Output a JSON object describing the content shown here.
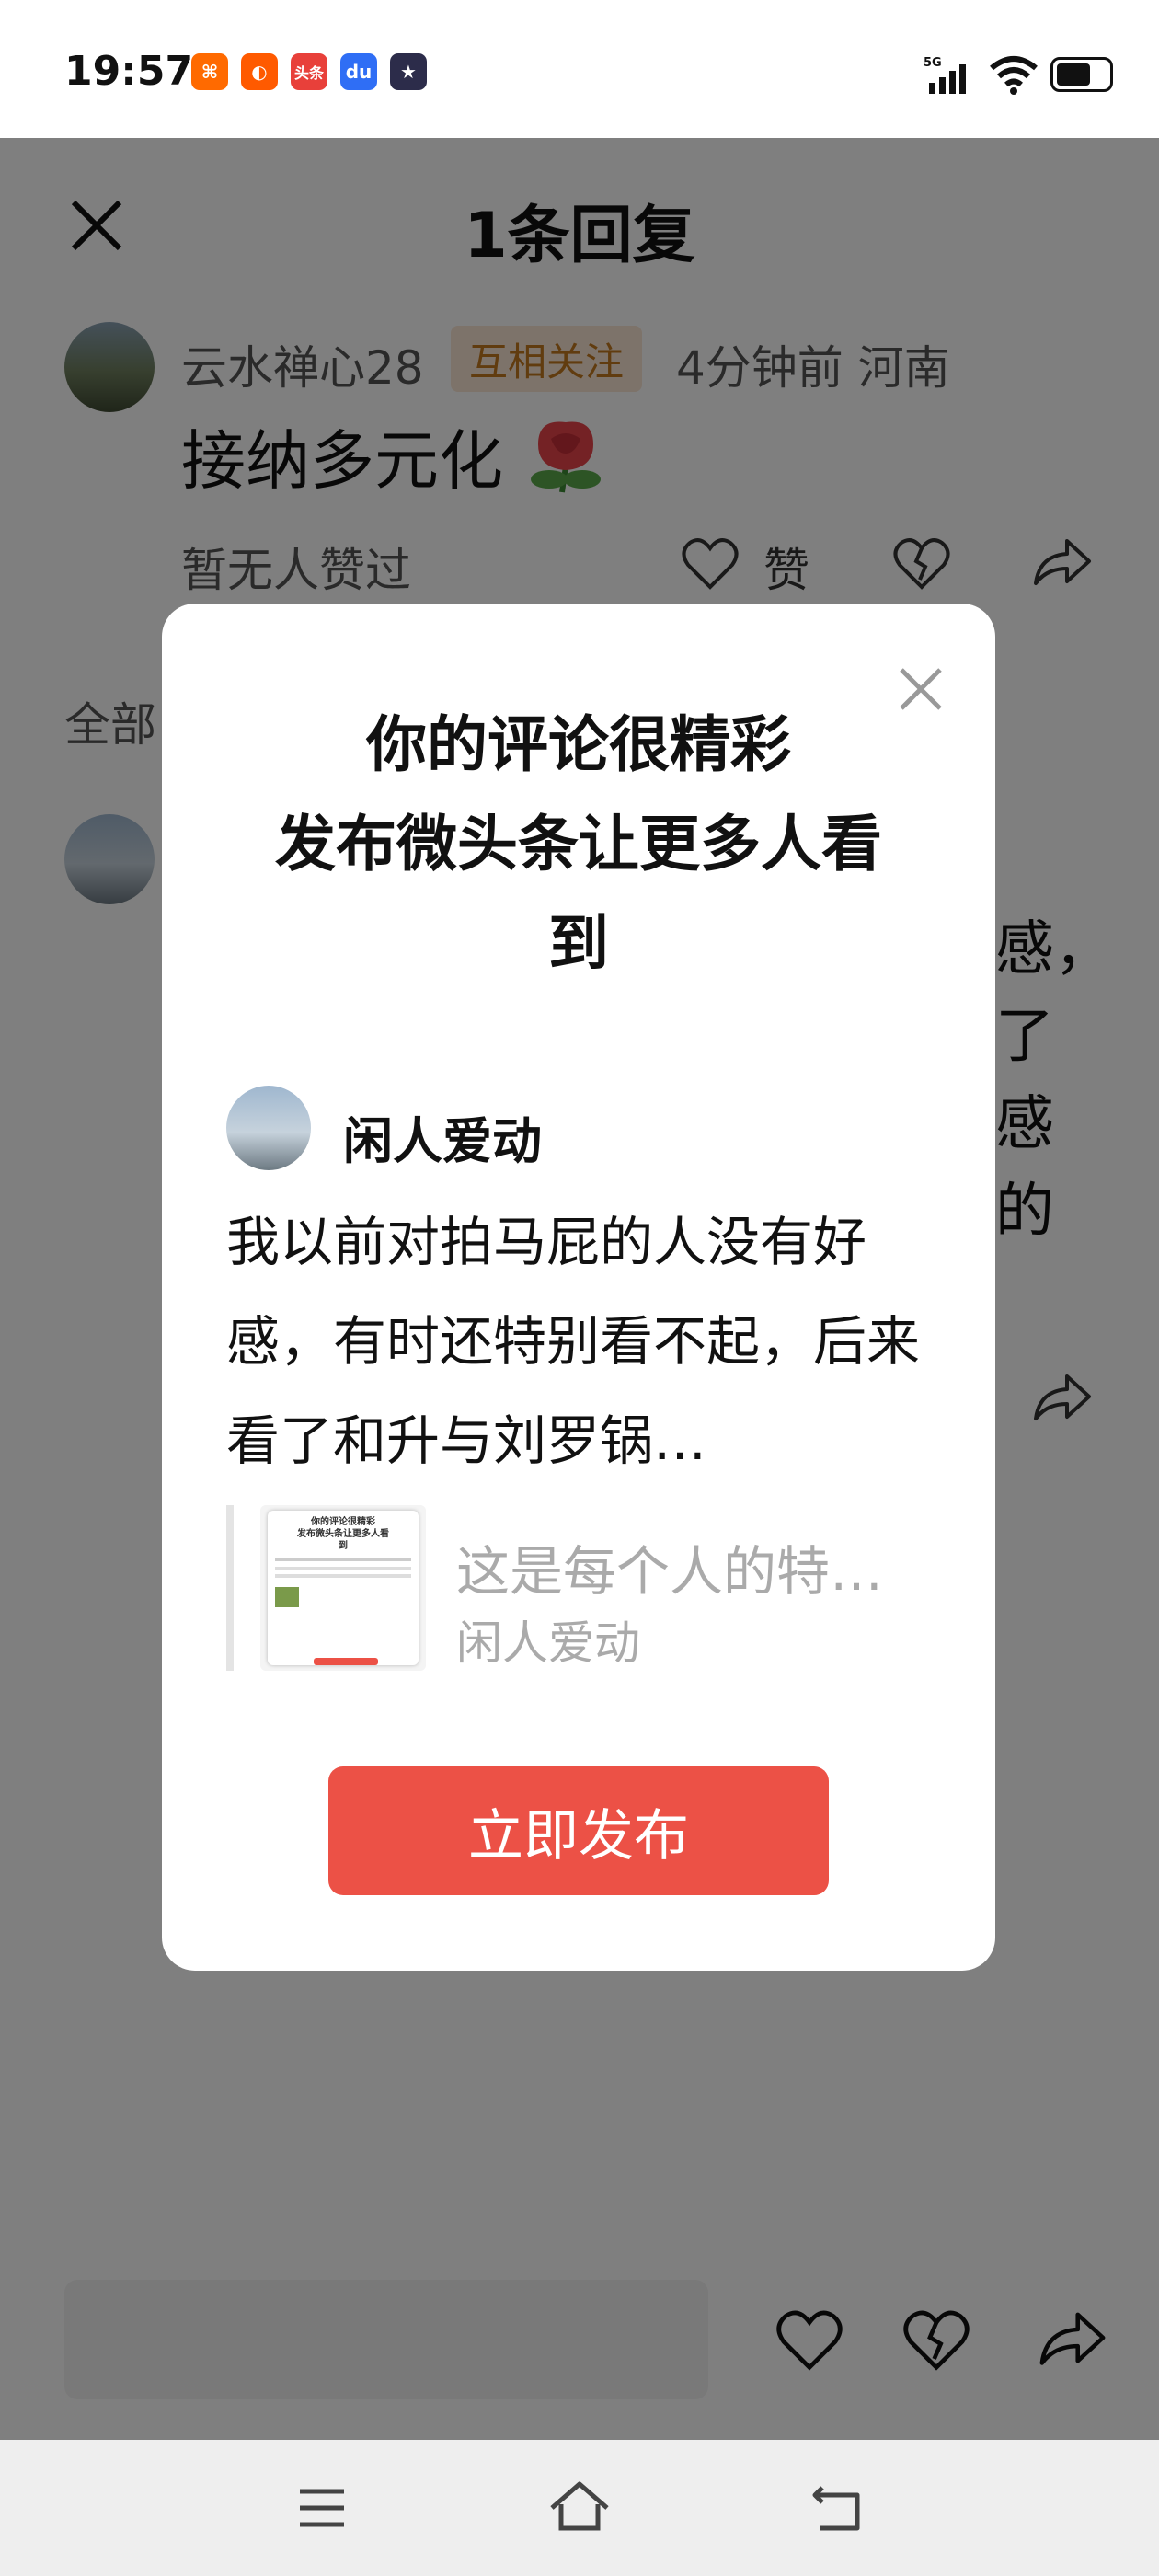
{
  "status_bar": {
    "time": "19:57",
    "app_icons": [
      {
        "name": "kuaishou-icon",
        "color": "#ff6a00",
        "glyph": "⌘"
      },
      {
        "name": "alibaba-1688-icon",
        "color": "#ff5a00",
        "glyph": "◐"
      },
      {
        "name": "toutiao-icon",
        "color": "#e8403a",
        "glyph": "头条"
      },
      {
        "name": "baidu-icon",
        "color": "#2f6ef5",
        "glyph": "du"
      },
      {
        "name": "game-app-icon",
        "color": "#2c2c4a",
        "glyph": "★"
      }
    ],
    "network": "5G"
  },
  "header": {
    "title": "1条回复"
  },
  "reply": {
    "username": "云水禅心28",
    "badge": "互相关注",
    "meta": "4分钟前  河南",
    "text": "接纳多元化",
    "no_likes": "暂无人赞过",
    "like_label": "赞"
  },
  "list": {
    "section_label": "全部",
    "partial_lines": [
      "感，",
      "了",
      "感",
      "的"
    ]
  },
  "dialog": {
    "title": "你的评论很精彩\n发布微头条让更多人看\n到",
    "author": "闲人爱动",
    "post_text": "我以前对拍马屁的人没有好感，有时还特别看不起，后来看了和升与刘罗锅…",
    "ref_title": "这是每个人的特…",
    "ref_author": "闲人爱动",
    "thumb_lines": [
      "你的评论很精彩",
      "发布微头条让更多人看",
      "到"
    ],
    "publish_label": "立即发布"
  },
  "colors": {
    "accent": "#ec5146",
    "badge_bg": "#fbe7d4",
    "badge_text": "#c2781f"
  }
}
